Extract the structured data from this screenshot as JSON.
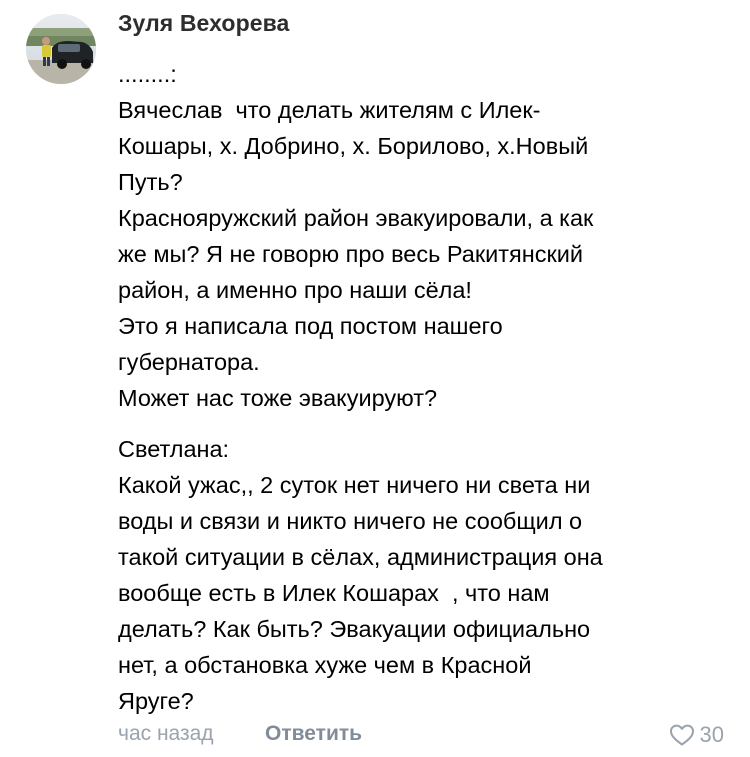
{
  "comment": {
    "author": "Зуля Вехорева",
    "avatar_icon": "user-avatar-photo",
    "paragraphs": [
      [
        "........:",
        "Вячеслав  что делать жителям с Илек-",
        "Кошары, х. Добрино, х. Борилово, х.Новый",
        "Путь?",
        "Краснояружский район эвакуировали, а как",
        "же мы? Я не говорю про весь Ракитянский",
        "район, а именно про наши сёла!",
        "Это я написала под постом нашего",
        "губернатора.",
        "Может нас тоже эвакуируют?"
      ],
      [
        "Светлана:",
        "Какой ужас,, 2 суток нет ничего ни света ни",
        "воды и связи и никто ничего не сообщил о",
        "такой ситуации в сёлах, администрация она",
        "вообще есть в Илек Кошарах  , что нам",
        "делать? Как быть? Эвакуации официально",
        "нет, а обстановка хуже чем в Красной",
        "Яруге?"
      ]
    ],
    "time": "час назад",
    "reply_label": "Ответить",
    "like_icon": "heart-outline-icon",
    "likes": "30"
  },
  "colors": {
    "author": "#2c2d2e",
    "text": "#000000",
    "meta": "#99a2ad",
    "reply": "#818c99"
  }
}
